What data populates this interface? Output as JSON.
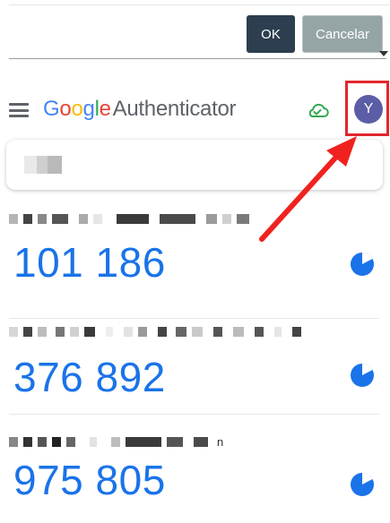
{
  "dialog": {
    "ok_label": "OK",
    "cancel_label": "Cancelar",
    "ok_color": "#2c3e50",
    "cancel_color": "#95a5a6"
  },
  "app": {
    "brand_letters": [
      "G",
      "o",
      "o",
      "g",
      "l",
      "e"
    ],
    "app_name": "Authenticator",
    "menu_icon": "hamburger-menu-icon",
    "sync_icon": "cloud-check-icon",
    "avatar_initial": "Y",
    "avatar_color": "#5b5ea6",
    "highlight_color": "#e0262c",
    "code_color": "#1a73e8"
  },
  "accounts": [
    {
      "code": "101 186",
      "label_suffix": ""
    },
    {
      "code": "376 892",
      "label_suffix": ""
    },
    {
      "code": "975 805",
      "label_suffix": "n"
    }
  ]
}
